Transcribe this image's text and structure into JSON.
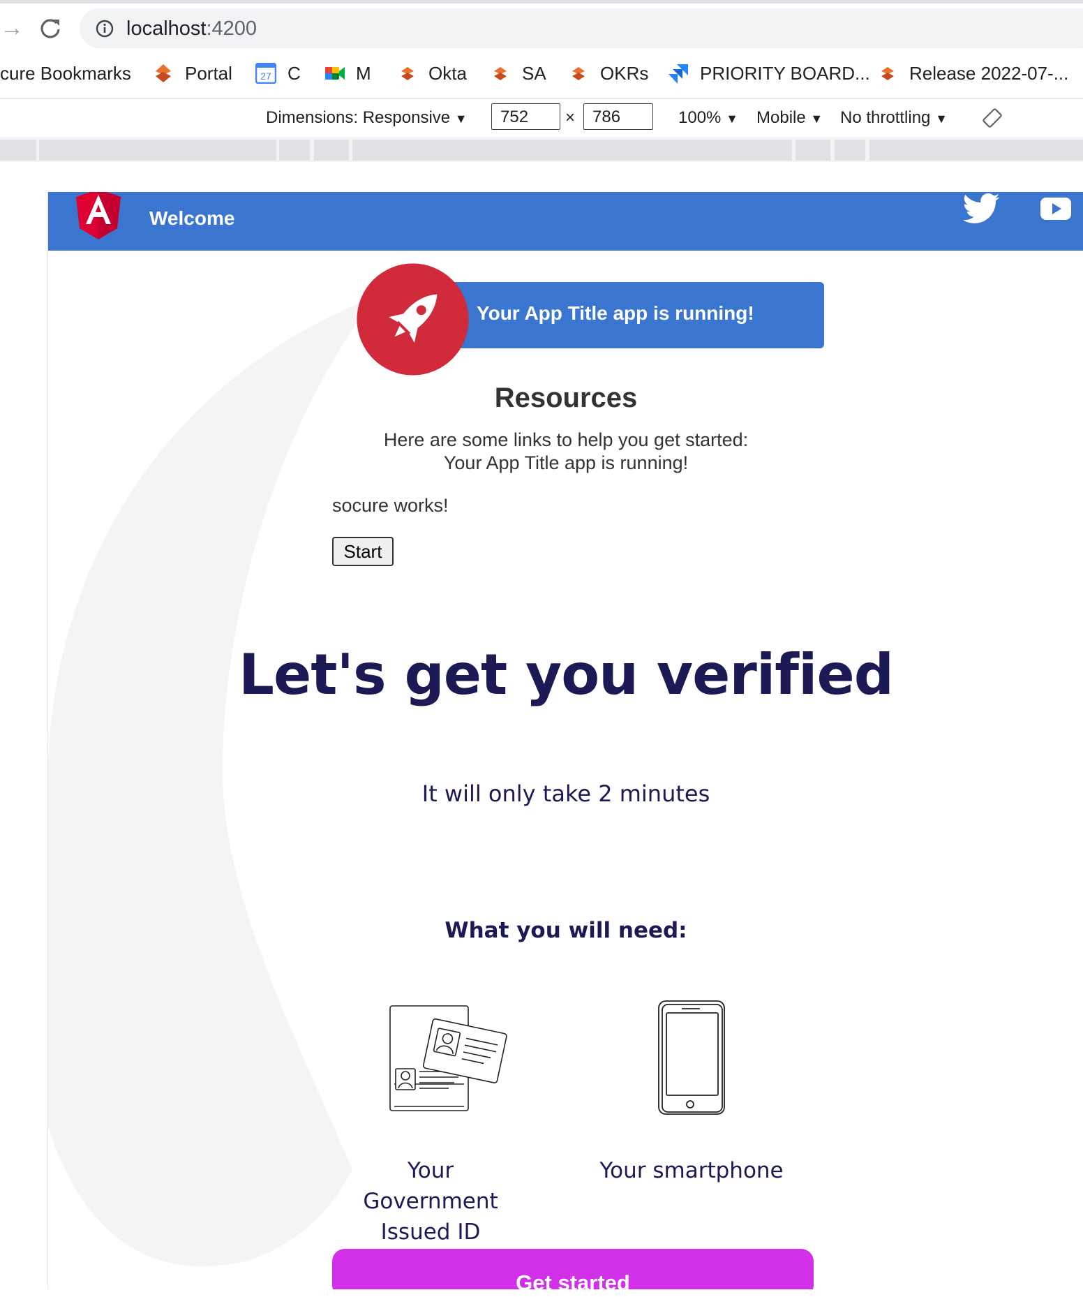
{
  "browser": {
    "url_host": "localhost",
    "url_port": ":4200",
    "bookmarks": [
      {
        "label": "cure Bookmarks",
        "icon": "folder-icon"
      },
      {
        "label": "Portal",
        "icon": "orange-diamond-icon"
      },
      {
        "label": "C",
        "icon": "calendar-icon",
        "badge": "27"
      },
      {
        "label": "M",
        "icon": "meet-icon"
      },
      {
        "label": "Okta",
        "icon": "orange-diamond-icon"
      },
      {
        "label": "SA",
        "icon": "orange-diamond-icon"
      },
      {
        "label": "OKRs",
        "icon": "orange-diamond-icon"
      },
      {
        "label": "PRIORITY BOARD...",
        "icon": "jira-icon"
      },
      {
        "label": "Release 2022-07-...",
        "icon": "orange-diamond-icon"
      }
    ]
  },
  "devtools": {
    "dimensions_label": "Dimensions: Responsive",
    "width_value": "752",
    "times": "×",
    "height_value": "786",
    "zoom": "100%",
    "device_type": "Mobile",
    "throttling": "No throttling",
    "arrow": "▼"
  },
  "app": {
    "toolbar_title": "Welcome",
    "toolbar_color": "#3a76cf",
    "running_text": "Your App Title app is running!",
    "resources_title": "Resources",
    "resources_sub1": "Here are some links to help you get started:",
    "resources_sub2": "Your App Title app is running!",
    "socure_works": "socure works!",
    "start_button": "Start",
    "verified_title": "Let's get you verified",
    "two_minutes": "It will only take 2 minutes",
    "need_title": "What you will need:",
    "id_label": "Your Government Issued ID",
    "phone_label": "Your smartphone",
    "get_started": "Get started",
    "accent_color": "#d22fe8",
    "heading_color": "#1b1a55"
  }
}
